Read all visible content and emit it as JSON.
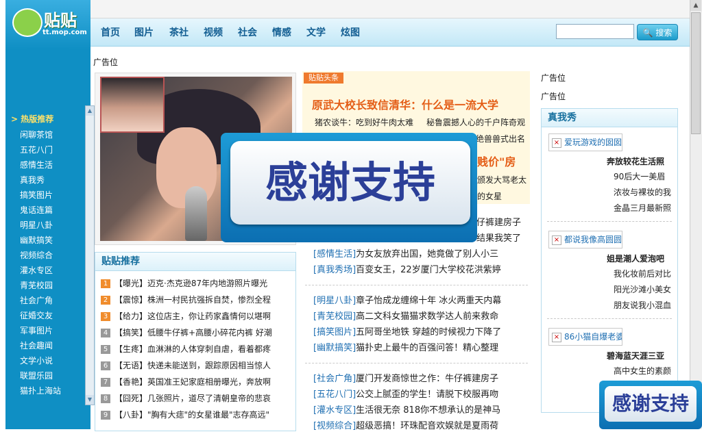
{
  "logo": {
    "text": "贴贴",
    "sub": "tt.mop.com"
  },
  "nav": [
    "首页",
    "图片",
    "茶社",
    "视频",
    "社会",
    "情感",
    "文学",
    "炫图"
  ],
  "search": {
    "button": "搜索",
    "value": ""
  },
  "sidebar": {
    "hot": "> 热版推荐",
    "items": [
      "闲聊茶馆",
      "五花八门",
      "感情生活",
      "真我秀",
      "搞笑图片",
      "鬼话连篇",
      "明星八卦",
      "幽默搞笑",
      "视频综合",
      "灌水专区",
      "青芜校园",
      "社会广角",
      "征婚交友",
      "军事图片",
      "社会趣闻",
      "文学小说",
      "联盟乐园",
      "猫扑上海站"
    ]
  },
  "ads": {
    "left": "广告位",
    "right1": "广告位",
    "right2": "广告位"
  },
  "rank": {
    "title": "贴贴推荐",
    "colors": [
      "#f08c2c",
      "#f08c2c",
      "#f08c2c",
      "#999999",
      "#999999",
      "#999999",
      "#999999",
      "#999999",
      "#999999"
    ],
    "items": [
      {
        "num": "1",
        "text": "【曝光】迈克·杰克逊87年内地游照片曝光"
      },
      {
        "num": "2",
        "text": "【震惊】株洲一村民抗强拆自焚，惨烈全程"
      },
      {
        "num": "3",
        "text": "【给力】这位店主，你让药家鑫情何以堪啊"
      },
      {
        "num": "4",
        "text": "【搞笑】低腰牛仔裤+高腰小碎花内裤 好潮"
      },
      {
        "num": "5",
        "text": "【生疼】血淋淋的人体穿刺自虐，看着都疼"
      },
      {
        "num": "6",
        "text": "【无语】快递未能送到，跟踪原因相当惊人"
      },
      {
        "num": "7",
        "text": "【香艳】英国准王妃家庭相册曝光，奔放啊"
      },
      {
        "num": "8",
        "text": "【囧死】几张照片，道尽了清朝皇帝的悲哀"
      },
      {
        "num": "9",
        "text": "【八卦】\"胸有大痣\"的女星谁最\"志存高远\""
      }
    ]
  },
  "headline": {
    "tag": "贴贴头条",
    "title": "原武大校长致信清华：什么是一流大学",
    "sub1a": "猪农谈牛：吃到好牛肉太难",
    "sub1b": "秘鲁震撼人心的千户阵奇观",
    "sub2": "绝兽兽式出名",
    "sub3": "贱价\"房",
    "sub4": "颁发大骂老太",
    "sub5": "的女星"
  },
  "categories": {
    "group1": [
      {
        "tag": "",
        "text": "牛仔裤建房子"
      },
      {
        "tag": "",
        "text": "结果我笑了"
      },
      {
        "tag": "[感情生活]",
        "text": "为女友放弃出国，她竟做了别人小三"
      },
      {
        "tag": "[真我秀场]",
        "text": "百变女王，22岁厦门大学校花洪紫婷"
      }
    ],
    "group2": [
      {
        "tag": "[明星八卦]",
        "text": "章子怡成龙缠绵十年 冰火两重天内幕"
      },
      {
        "tag": "[青芜校园]",
        "text": "高二文科女猫猫求数学达人前来救命"
      },
      {
        "tag": "[搞笑图片]",
        "text": "五阿哥坐地铁 穿越的时候视力下降了"
      },
      {
        "tag": "[幽默搞笑]",
        "text": "猫扑史上最牛的百强问答！精心整理"
      }
    ],
    "group3": [
      {
        "tag": "[社会广角]",
        "text": "厦门开发商惊世之作：牛仔裤建房子"
      },
      {
        "tag": "[五花八门]",
        "text": "公交上腻歪的学生！请脱下校服再吻"
      },
      {
        "tag": "[灌水专区]",
        "text": "生活很无奈 818你不想承认的是神马"
      },
      {
        "tag": "[视频综合]",
        "text": "超级恶搞！环珠配音欢娱就是夏雨荷"
      }
    ]
  },
  "show": {
    "title": "真我秀",
    "groups": [
      {
        "img": "爱玩游戏的囡囡",
        "name": "奔放较花生活照",
        "lines": [
          "90后大一美眉",
          "浓妆与裸妆的我",
          "金晶三月最新照"
        ]
      },
      {
        "img": "都说我像高圆圆",
        "name": "姐是潮人爱泡吧",
        "lines": [
          "我化妆前后对比",
          "阳光沙滩小美女",
          "朋友说我小混血"
        ]
      },
      {
        "img": "86小猫自爆老婆",
        "name": "碧海蓝天涯三亚",
        "lines": [
          "高中女生的素颜",
          ""
        ]
      }
    ]
  },
  "overlay": {
    "text": "感谢支持"
  }
}
